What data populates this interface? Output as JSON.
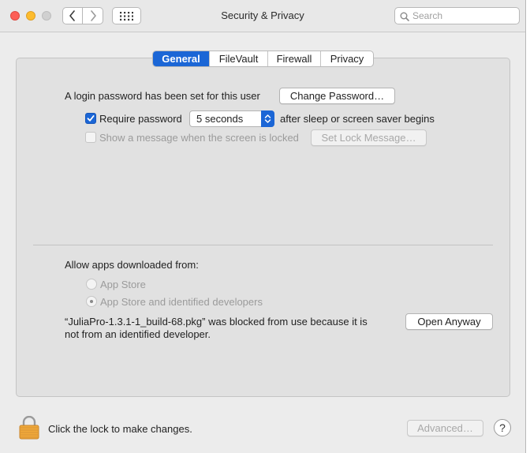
{
  "window": {
    "title": "Security & Privacy"
  },
  "search": {
    "placeholder": "Search"
  },
  "tabs": [
    {
      "label": "General",
      "active": true
    },
    {
      "label": "FileVault",
      "active": false
    },
    {
      "label": "Firewall",
      "active": false
    },
    {
      "label": "Privacy",
      "active": false
    }
  ],
  "general": {
    "login_password_text": "A login password has been set for this user",
    "change_password_label": "Change Password…",
    "require_password_label": "Require password",
    "require_password_checked": true,
    "require_password_delay": "5 seconds",
    "after_sleep_text": "after sleep or screen saver begins",
    "show_message_label": "Show a message when the screen is locked",
    "show_message_checked": false,
    "set_lock_message_label": "Set Lock Message…"
  },
  "allow_apps": {
    "heading": "Allow apps downloaded from:",
    "options": [
      {
        "label": "App Store",
        "selected": false
      },
      {
        "label": "App Store and identified developers",
        "selected": true
      }
    ],
    "blocked_line1": "“JuliaPro-1.3.1-1_build-68.pkg” was blocked from use because it is",
    "blocked_line2": "not from an identified developer.",
    "open_anyway_label": "Open Anyway"
  },
  "footer": {
    "lock_text": "Click the lock to make changes.",
    "advanced_label": "Advanced…",
    "help_label": "?"
  },
  "colors": {
    "accent": "#1b66d6",
    "close": "#fc5f57",
    "minimize": "#fdbc2e",
    "lock": "#f0a93a"
  },
  "icons": {
    "back": "chevron-left-icon",
    "forward": "chevron-right-icon",
    "grid": "grid-icon",
    "search": "search-icon",
    "lock": "lock-icon",
    "checkmark": "checkmark-icon",
    "select_arrows": "updown-arrows-icon"
  }
}
